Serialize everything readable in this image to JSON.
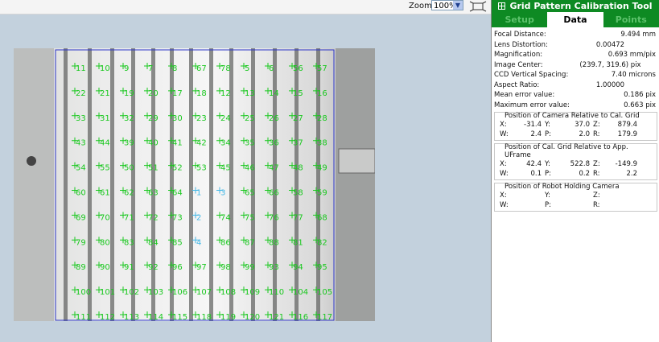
{
  "toolbar": {
    "zoom_label": "Zoom:",
    "zoom_value": "100%"
  },
  "panel": {
    "title": "Grid Pattern Calibration Tool",
    "tabs": [
      "Setup",
      "Data",
      "Points"
    ],
    "rows": [
      {
        "label": "Focal Distance:",
        "value": "9.494 mm",
        "align": "right"
      },
      {
        "label": "Lens Distortion:",
        "value": "0.00472",
        "align": "center"
      },
      {
        "label": "Magnification:",
        "value": "0.693 mm/pix",
        "align": "right"
      },
      {
        "label": "Image Center:",
        "value": "(239.7, 319.6) pix",
        "align": "center"
      },
      {
        "label": "CCD Vertical Spacing:",
        "value": "7.40 microns",
        "align": "right"
      },
      {
        "label": "Aspect Ratio:",
        "value": "1.00000",
        "align": "center"
      },
      {
        "label": "Mean error value:",
        "value": "0.186 pix",
        "align": "right"
      },
      {
        "label": "Maximum error value:",
        "value": "0.663 pix",
        "align": "right"
      }
    ],
    "groups": [
      {
        "title": "Position of Camera Relative to Cal. Grid",
        "lines": [
          [
            "X:",
            "-31.4",
            "Y:",
            "37.0",
            "Z:",
            "879.4"
          ],
          [
            "W:",
            "2.4",
            "P:",
            "2.0",
            "R:",
            "179.9"
          ]
        ]
      },
      {
        "title": "Position of Cal. Grid Relative to App. UFrame",
        "lines": [
          [
            "X:",
            "42.4",
            "Y:",
            "522.8",
            "Z:",
            "-149.9"
          ],
          [
            "W:",
            "0.1",
            "P:",
            "0.2",
            "R:",
            "2.2"
          ]
        ]
      },
      {
        "title": "Position of Robot Holding Camera",
        "lines": [
          [
            "X:",
            "",
            "Y:",
            "",
            "Z:",
            ""
          ],
          [
            "W:",
            "",
            "P:",
            "",
            "R:",
            ""
          ]
        ]
      }
    ]
  },
  "grid_labels": [
    [
      "11",
      "10",
      "9",
      "7",
      "8",
      "67",
      "78",
      "5",
      "6",
      "56",
      "57"
    ],
    [
      "22",
      "21",
      "19",
      "20",
      "17",
      "18",
      "12",
      "13",
      "14",
      "15",
      "16"
    ],
    [
      "33",
      "31",
      "32",
      "29",
      "30",
      "23",
      "24",
      "25",
      "26",
      "27",
      "28"
    ],
    [
      "43",
      "44",
      "39",
      "40",
      "41",
      "42",
      "34",
      "35",
      "36",
      "37",
      "38"
    ],
    [
      "54",
      "55",
      "50",
      "51",
      "52",
      "53",
      "45",
      "46",
      "47",
      "48",
      "49"
    ],
    [
      "60",
      "61",
      "62",
      "63",
      "64",
      "1",
      "3",
      "65",
      "66",
      "58",
      "59"
    ],
    [
      "69",
      "70",
      "71",
      "72",
      "73",
      "2",
      "74",
      "75",
      "76",
      "77",
      "68"
    ],
    [
      "79",
      "80",
      "83",
      "84",
      "85",
      "4",
      "86",
      "87",
      "88",
      "81",
      "82"
    ],
    [
      "89",
      "90",
      "91",
      "92",
      "96",
      "97",
      "98",
      "99",
      "93",
      "94",
      "95"
    ],
    [
      "100",
      "101",
      "102",
      "103",
      "106",
      "107",
      "108",
      "109",
      "110",
      "104",
      "105"
    ],
    [
      "111",
      "112",
      "113",
      "114",
      "115",
      "118",
      "119",
      "120",
      "121",
      "116",
      "117"
    ]
  ],
  "grid_label_colors": {
    "normal": "#19c81e",
    "special": "#43b8e6",
    "marker": "#8a7500"
  }
}
